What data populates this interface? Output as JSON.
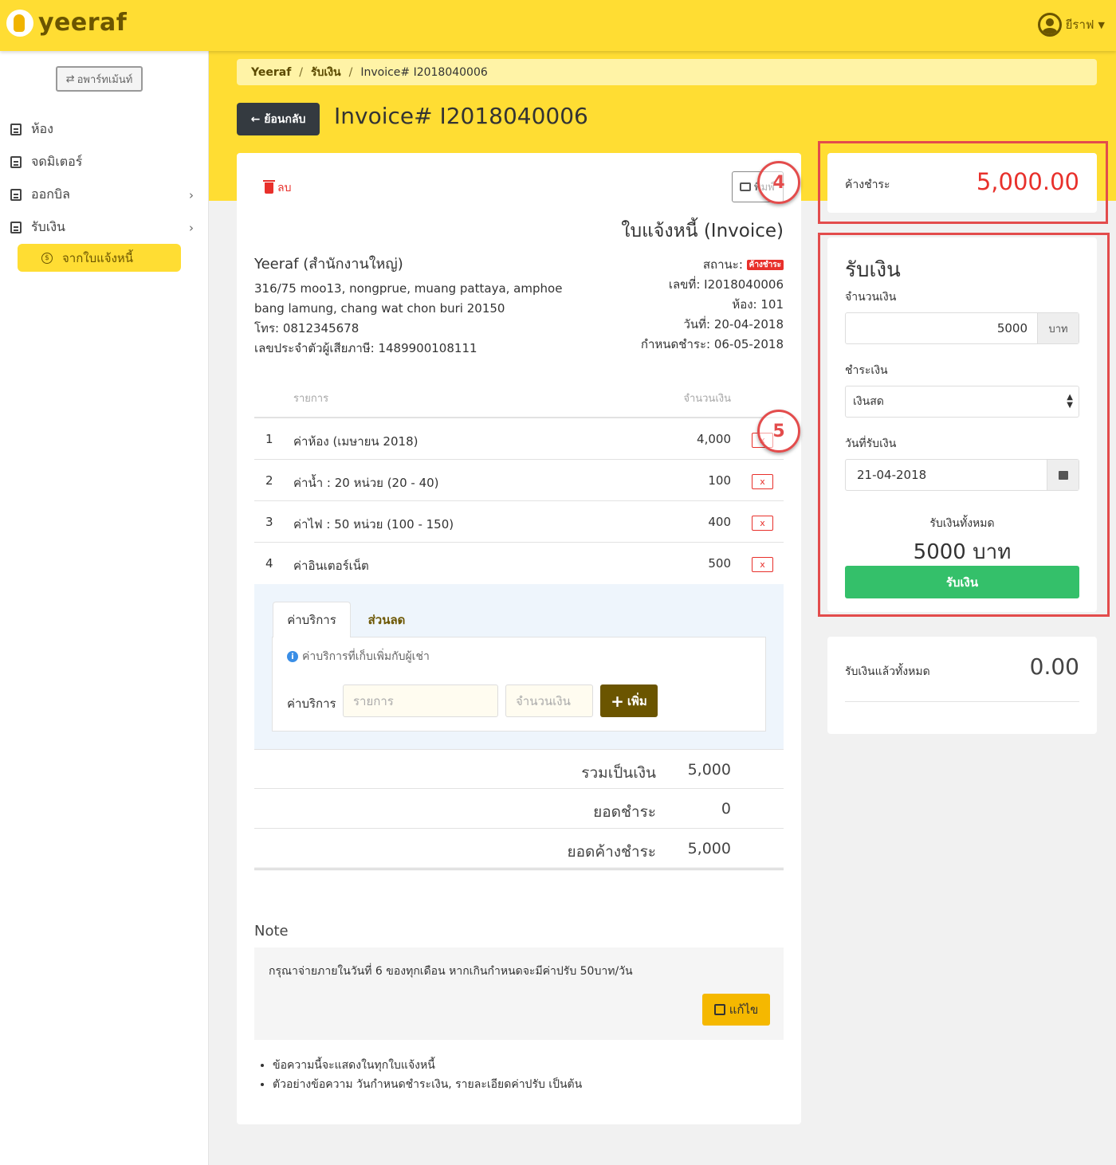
{
  "app": {
    "logo_text": "yeeraf",
    "user_name": "ยีราฟ"
  },
  "sidebar": {
    "apartment_button": "อพาร์ทเม้นท์",
    "items": [
      {
        "label": "ห้อง"
      },
      {
        "label": "จดมิเตอร์"
      },
      {
        "label": "ออกบิล"
      },
      {
        "label": "รับเงิน"
      }
    ],
    "sub_item": "จากใบแจ้งหนี้"
  },
  "breadcrumb": {
    "root": "Yeeraf",
    "section": "รับเงิน",
    "current": "Invoice# I2018040006"
  },
  "header": {
    "back_label": "ย้อนกลับ",
    "title": "Invoice# I2018040006"
  },
  "invoice": {
    "delete_label": "ลบ",
    "print_label": "พิมพ์",
    "doc_title": "ใบแจ้งหนี้ (Invoice)",
    "company": "Yeeraf (สำนักงานใหญ่)",
    "address_line1": "316/75 moo13, nongprue, muang pattaya, amphoe",
    "address_line2": "bang lamung, chang wat chon buri 20150",
    "phone": "โทร: 0812345678",
    "tax_id": "เลขประจำตัวผู้เสียภาษี: 1489900108111",
    "status_label": "สถานะ:",
    "status_badge": "ค้างชำระ",
    "number": "เลขที่: I2018040006",
    "room": "ห้อง: 101",
    "date": "วันที่: 20-04-2018",
    "due": "กำหนดชำระ: 06-05-2018",
    "col_item": "รายการ",
    "col_amount": "จำนวนเงิน",
    "rows": [
      {
        "no": "1",
        "desc": "ค่าห้อง (เมษายน 2018)",
        "amount": "4,000",
        "remove": "x"
      },
      {
        "no": "2",
        "desc": "ค่าน้ำ : 20 หน่วย (20 - 40)",
        "amount": "100",
        "remove": "x"
      },
      {
        "no": "3",
        "desc": "ค่าไฟ : 50 หน่วย (100 - 150)",
        "amount": "400",
        "remove": "x"
      },
      {
        "no": "4",
        "desc": "ค่าอินเตอร์เน็ต",
        "amount": "500",
        "remove": "x"
      }
    ],
    "tabs": [
      {
        "label": "ค่าบริการ"
      },
      {
        "label": "ส่วนลด"
      }
    ],
    "fee_info": "ค่าบริการที่เก็บเพิ่มกับผู้เช่า",
    "fee_label": "ค่าบริการ",
    "fee_item_placeholder": "รายการ",
    "fee_amount_placeholder": "จำนวนเงิน",
    "add_label": "เพิ่ม",
    "totals": [
      {
        "label": "รวมเป็นเงิน",
        "value": "5,000"
      },
      {
        "label": "ยอดชำระ",
        "value": "0"
      },
      {
        "label": "ยอดค้างชำระ",
        "value": "5,000"
      }
    ],
    "note_title": "Note",
    "note_text": "กรุณาจ่ายภายในวันที่ 6 ของทุกเดือน หากเกินกำหนดจะมีค่าปรับ 50บาท/วัน",
    "edit_label": "แก้ไข",
    "hints": [
      "ข้อความนี้จะแสดงในทุกใบแจ้งหนี้",
      "ตัวอย่างข้อความ วันกำหนดชำระเงิน, รายละเอียดค่าปรับ เป็นต้น"
    ]
  },
  "outstanding": {
    "label": "ค้างชำระ",
    "value": "5,000.00"
  },
  "payment": {
    "title": "รับเงิน",
    "amount_label": "จำนวนเงิน",
    "amount_value": "5000",
    "amount_unit": "บาท",
    "method_label": "ชำระเงิน",
    "method_value": "เงินสด",
    "date_label": "วันที่รับเงิน",
    "date_value": "21-04-2018",
    "total_label": "รับเงินทั้งหมด",
    "total_value": "5000 บาท",
    "submit_label": "รับเงิน"
  },
  "received": {
    "label": "รับเงินแล้วทั้งหมด",
    "value": "0.00"
  },
  "annotations": {
    "marker_4": "4",
    "marker_5": "5"
  },
  "colors": {
    "brand_yellow": "#ffdd33",
    "brand_brown": "#6b5500",
    "danger": "#e8302b",
    "success": "#34c06a",
    "annotation_red": "#e34c4c"
  }
}
